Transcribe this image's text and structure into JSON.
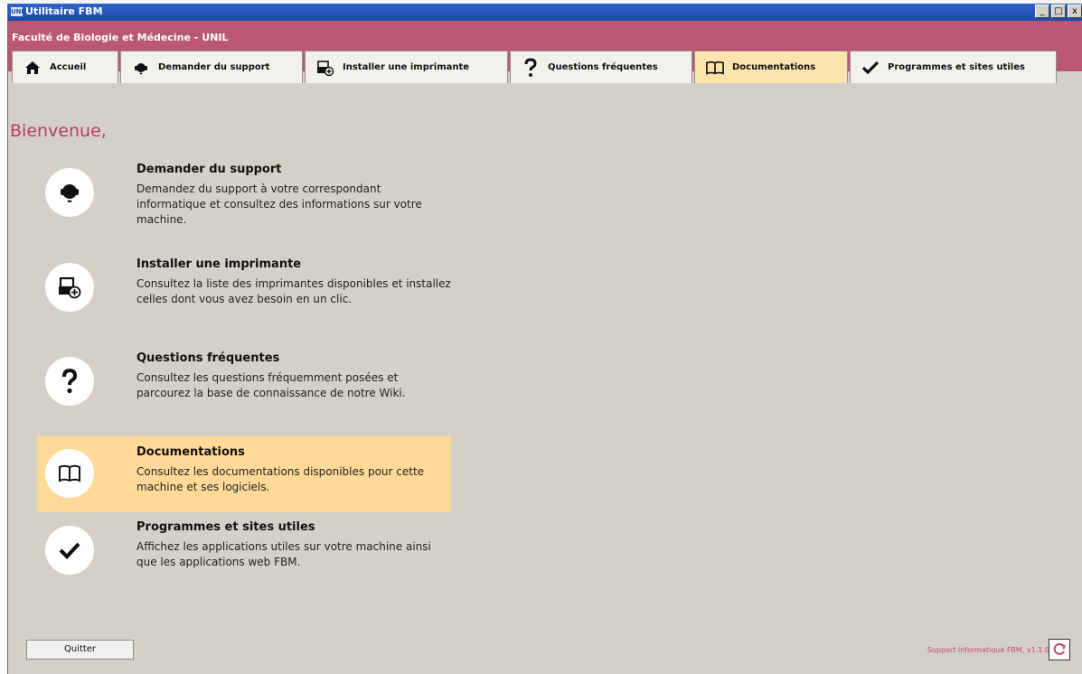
{
  "window": {
    "title": "Utilitaire FBM",
    "logo_text": "UNI",
    "controls": [
      "_",
      "□",
      "x"
    ]
  },
  "banner": {
    "title": "Faculté de Biologie et Médecine - UNIL"
  },
  "tabs": [
    {
      "label": "Accueil",
      "icon": "home-icon"
    },
    {
      "label": "Demander du support",
      "icon": "support-headset-icon"
    },
    {
      "label": "Installer une imprimante",
      "icon": "printer-add-icon"
    },
    {
      "label": "Questions fréquentes",
      "icon": "question-icon"
    },
    {
      "label": "Documentations",
      "icon": "book-icon",
      "active": true
    },
    {
      "label": "Programmes et sites utiles",
      "icon": "check-icon"
    }
  ],
  "welcome": "Bienvenue,",
  "items": [
    {
      "title": "Demander du support",
      "description": "Demandez du support à votre correspondant informatique et consultez des informations sur votre machine.",
      "icon": "support-headset-icon"
    },
    {
      "title": "Installer une imprimante",
      "description": "Consultez la liste des imprimantes disponibles et installez celles dont vous avez besoin en un clic.",
      "icon": "printer-add-icon"
    },
    {
      "title": "Questions fréquentes",
      "description": "Consultez les questions fréquemment posées et parcourez la base de connaissance de notre Wiki.",
      "icon": "question-icon"
    },
    {
      "title": "Documentations",
      "description": "Consultez les documentations disponibles pour cette machine et ses logiciels.",
      "icon": "book-icon",
      "highlight": true
    },
    {
      "title": "Programmes et sites utiles",
      "description": "Affichez les applications utiles sur votre machine ainsi que les applications web FBM.",
      "icon": "check-icon"
    }
  ],
  "footer": {
    "quit_label": "Quitter",
    "support_text": "Support informatique FBM, v1.1.0",
    "refresh_icon": "refresh-icon"
  },
  "colors": {
    "banner": "#b85872",
    "welcome_text": "#bd3b5e",
    "active_tab": "#fde3ad",
    "highlight_item": "#ffd997"
  }
}
